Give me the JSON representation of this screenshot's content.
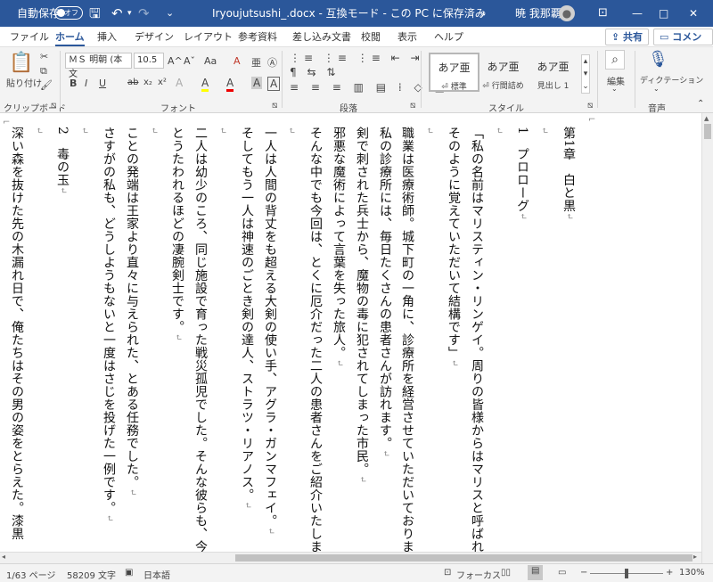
{
  "titlebar": {
    "autosave_label": "自動保存",
    "autosave_state": "オフ",
    "title": "Iryoujutsushi_.docx  -  互換モード - この PC に保存済み",
    "user_name": "暁 我那覇",
    "minimize": "—",
    "maximize": "□",
    "close": "✕"
  },
  "tabs": [
    "ファイル",
    "ホーム",
    "挿入",
    "デザイン",
    "レイアウト",
    "参考資料",
    "差し込み文書",
    "校閲",
    "表示",
    "ヘルプ"
  ],
  "share_label": "共有",
  "comment_label": "コメント",
  "ribbon": {
    "clipboard": {
      "paste_label": "貼り付け",
      "group_label": "クリップボード"
    },
    "font": {
      "font_name": "ＭＳ 明朝 (本文",
      "font_size": "10.5",
      "group_label": "フォント",
      "bold": "B",
      "italic": "I",
      "underline": "U",
      "strike": "ab",
      "sub": "x₂",
      "sup": "x²",
      "grow": "A^",
      "shrink": "Aˇ",
      "case": "Aa",
      "clear": "A",
      "highlight": "A",
      "color": "A",
      "shade": "A",
      "border_char": "A"
    },
    "paragraph": {
      "group_label": "段落"
    },
    "styles": {
      "group_label": "スタイル",
      "items": [
        {
          "preview": "あア亜",
          "name": "⏎ 標準"
        },
        {
          "preview": "あア亜",
          "name": "⏎ 行間詰め"
        },
        {
          "preview": "あア亜",
          "name": "見出し 1"
        }
      ]
    },
    "editing": {
      "label": "編集"
    },
    "dictation": {
      "label": "ディクテーション",
      "group_label": "音声"
    }
  },
  "document": {
    "lines": [
      {
        "text": "第1章　白と黒",
        "mark": "↵"
      },
      {
        "text": "",
        "mark": "↵"
      },
      {
        "text": "1　プロローグ",
        "mark": "↵"
      },
      {
        "text": "",
        "mark": "↵"
      },
      {
        "text": "「私の名前はマリスティン・リンゲイ。周りの皆様からはマリスと呼ばれて",
        "mark": ""
      },
      {
        "text": "そのように覚えていただいて結構です」",
        "mark": "↵"
      },
      {
        "text": "",
        "mark": "↵"
      },
      {
        "text": "職業は医療術師。城下町の一角に、診療所を経営させていただいております",
        "mark": ""
      },
      {
        "text": "私の診療所には、毎日たくさんの患者さんが訪れます。",
        "mark": "↵"
      },
      {
        "text": "剣で刺された兵士から、魔物の毒に犯されてしまった市民。",
        "mark": "↵"
      },
      {
        "text": "邪悪な魔術によって言葉を失った旅人。",
        "mark": "↵"
      },
      {
        "text": "そんな中でも今回は、とくに厄介だった二人の患者さんをご紹介いたします",
        "mark": ""
      },
      {
        "text": "",
        "mark": "↵"
      },
      {
        "text": "一人は人間の背丈をも超える大剣の使い手、アグラ・ガンマフェイ。",
        "mark": "↵"
      },
      {
        "text": "そしてもう一人は神速のごとき剣の達人、ストラツ・リアノス。",
        "mark": "↵"
      },
      {
        "text": "",
        "mark": "↵"
      },
      {
        "text": "二人は幼少のころ、同じ施設で育った戦災孤児でした。そんな彼らも、今や",
        "mark": ""
      },
      {
        "text": "とうたわれるほどの凄腕剣士です。",
        "mark": "↵"
      },
      {
        "text": "",
        "mark": "↵"
      },
      {
        "text": "ことの発端は王家より直々に与えられた、とある任務でした。",
        "mark": "↵"
      },
      {
        "text": "さすがの私も、どうしようもないと一度はさじを投げた一例です。",
        "mark": "↵"
      },
      {
        "text": "",
        "mark": "↵"
      },
      {
        "text": "2　毒の玉",
        "mark": "↵"
      },
      {
        "text": "",
        "mark": "↵"
      },
      {
        "text": "深い森を抜けた先の木漏れ日で、俺たちはその男の姿をとらえた。漆黒",
        "mark": ""
      }
    ]
  },
  "status": {
    "page": "1/63 ページ",
    "words": "58209 文字",
    "lang": "日本語",
    "focus": "フォーカス",
    "zoom": "130%",
    "zoom_minus": "−",
    "zoom_plus": "+"
  }
}
